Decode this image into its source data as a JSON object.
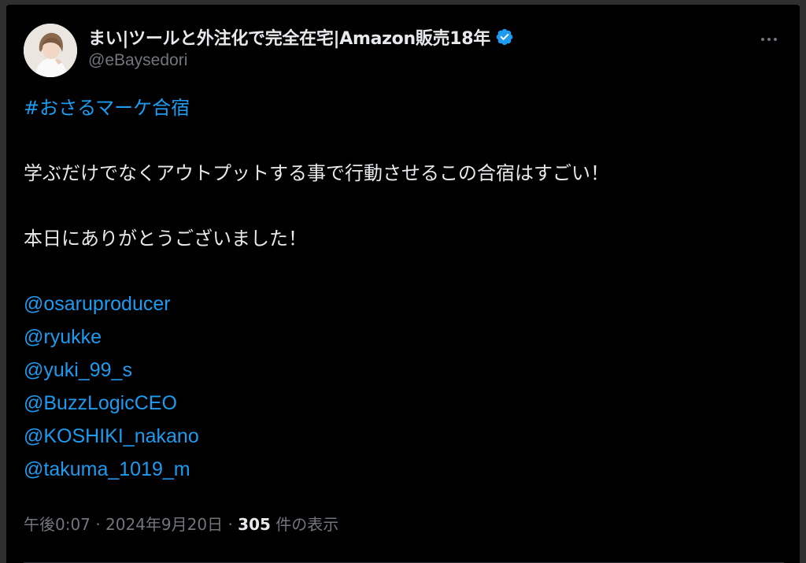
{
  "author": {
    "display_name": "まい|ツールと外注化で完全在宅|Amazon販売18年",
    "handle": "@eBaysedori",
    "verified_color": "#1d9bf0"
  },
  "tweet": {
    "hashtag": "#おさるマーケ合宿",
    "paragraph1": "学ぶだけでなくアウトプットする事で行動させるこの合宿はすごい！",
    "paragraph2": "本日にありがとうございました！",
    "mentions": [
      "@osaruproducer",
      "@ryukke",
      "@yuki_99_s",
      "@BuzzLogicCEO",
      "@KOSHIKI_nakano",
      "@takuma_1019_m"
    ]
  },
  "meta": {
    "time": "午後0:07",
    "separator": "·",
    "date": "2024年9月20日",
    "views_count": "305",
    "views_label": "件の表示"
  },
  "colors": {
    "background": "#000000",
    "text": "#e7e9ea",
    "muted": "#71767b",
    "link": "#1d9bf0"
  },
  "icons": {
    "verified": "verified-badge-icon",
    "more": "more-options-icon",
    "avatar": "avatar-image"
  }
}
